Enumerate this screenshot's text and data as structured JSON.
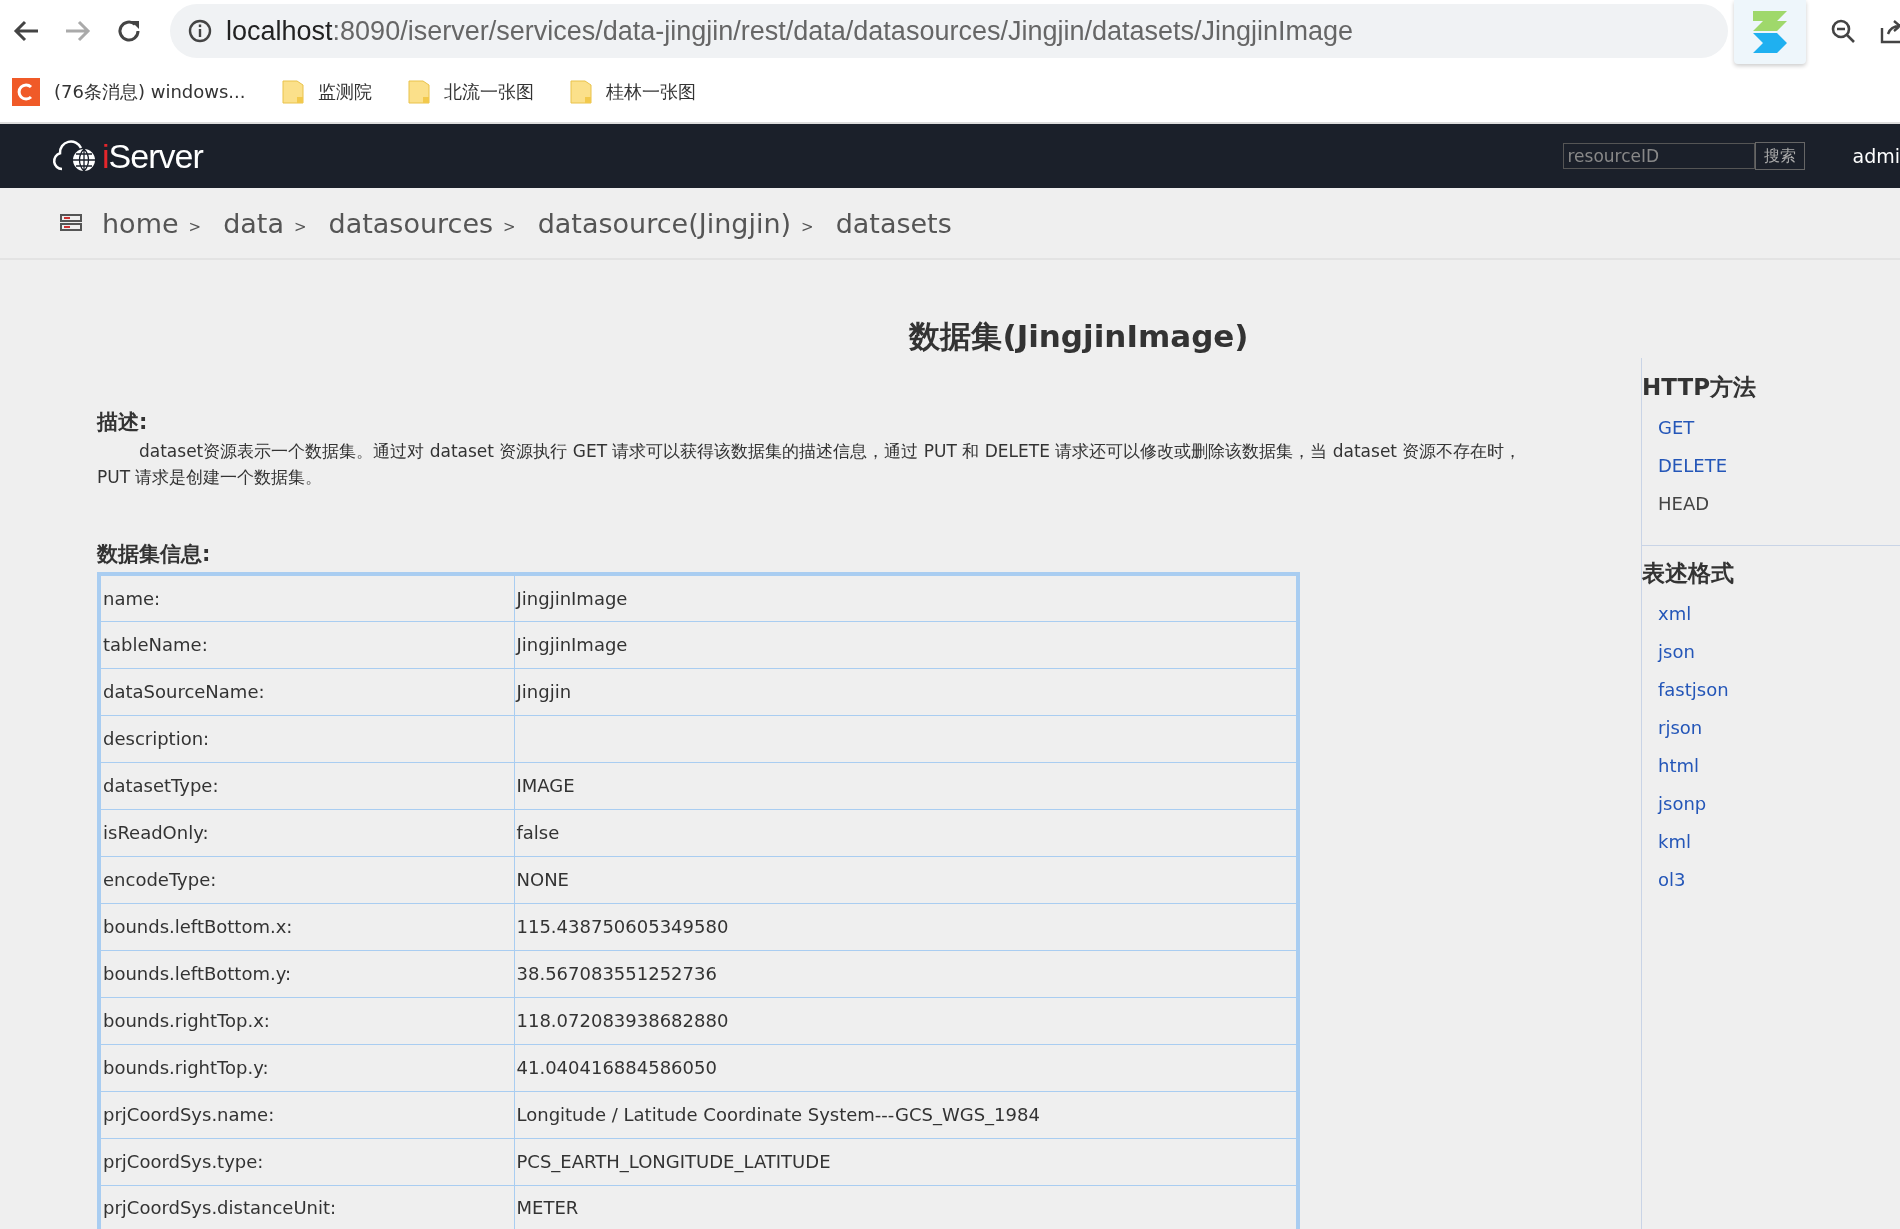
{
  "browser": {
    "url_host": "localhost",
    "url_path": ":8090/iserver/services/data-jingjin/rest/data/datasources/Jingjin/datasets/JingjinImage",
    "bookmarks": [
      {
        "label": "(76条消息) windows...",
        "kind": "site"
      },
      {
        "label": "监测院",
        "kind": "folder"
      },
      {
        "label": "北流一张图",
        "kind": "folder"
      },
      {
        "label": "桂林一张图",
        "kind": "folder"
      }
    ]
  },
  "header": {
    "logo": "iServer",
    "search": {
      "placeholder": "resourceID",
      "button": "搜索"
    },
    "user": "admi"
  },
  "breadcrumb": {
    "separator": ">",
    "items": [
      "home",
      "data",
      "datasources",
      "datasource(Jingjin)",
      "datasets"
    ]
  },
  "title": "数据集(JingjinImage)",
  "description": {
    "heading": "描述:",
    "text": "dataset资源表示一个数据集。通过对 dataset 资源执行 GET 请求可以获得该数据集的描述信息，通过 PUT 和 DELETE 请求还可以修改或删除该数据集，当 dataset 资源不存在时，PUT 请求是创建一个数据集。"
  },
  "info": {
    "heading": "数据集信息:",
    "rows": [
      {
        "key": "name:",
        "value": "JingjinImage"
      },
      {
        "key": "tableName:",
        "value": "JingjinImage"
      },
      {
        "key": "dataSourceName:",
        "value": "Jingjin"
      },
      {
        "key": "description:"
      },
      {
        "key": "datasetType:",
        "value": "IMAGE"
      },
      {
        "key": "isReadOnly:",
        "value": "false"
      },
      {
        "key": "encodeType:",
        "value": "NONE"
      },
      {
        "key": "bounds.leftBottom.x:",
        "value": "115.438750605349580"
      },
      {
        "key": "bounds.leftBottom.y:",
        "value": "38.567083551252736"
      },
      {
        "key": "bounds.rightTop.x:",
        "value": "118.072083938682880"
      },
      {
        "key": "bounds.rightTop.y:",
        "value": "41.040416884586050"
      },
      {
        "key": "prjCoordSys.name:",
        "value": "Longitude / Latitude Coordinate System---GCS_WGS_1984"
      },
      {
        "key": "prjCoordSys.type:",
        "value": "PCS_EARTH_LONGITUDE_LATITUDE"
      },
      {
        "key": "prjCoordSys.distanceUnit:",
        "value": "METER"
      }
    ]
  },
  "sidebar": [
    {
      "heading": "HTTP方法",
      "items": [
        {
          "label": "GET",
          "link": true
        },
        {
          "label": "DELETE",
          "link": true
        },
        {
          "label": "HEAD",
          "link": false
        }
      ]
    },
    {
      "heading": "表述格式",
      "items": [
        {
          "label": "xml",
          "link": true
        },
        {
          "label": "json",
          "link": true
        },
        {
          "label": "fastjson",
          "link": true
        },
        {
          "label": "rjson",
          "link": true
        },
        {
          "label": "html",
          "link": true
        },
        {
          "label": "jsonp",
          "link": true
        },
        {
          "label": "kml",
          "link": true
        },
        {
          "label": "ol3",
          "link": true
        }
      ]
    }
  ]
}
